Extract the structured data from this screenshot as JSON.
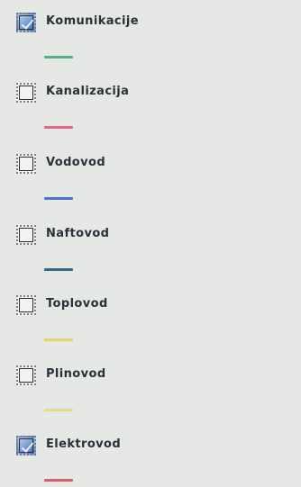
{
  "layers": [
    {
      "label": "Komunikacije",
      "checked": true,
      "color": "#58b08b"
    },
    {
      "label": "Kanalizacija",
      "checked": false,
      "color": "#e2668b"
    },
    {
      "label": "Vodovod",
      "checked": false,
      "color": "#4b75c8"
    },
    {
      "label": "Naftovod",
      "checked": false,
      "color": "#2f6b83"
    },
    {
      "label": "Toplovod",
      "checked": false,
      "color": "#e1d56a"
    },
    {
      "label": "Plinovod",
      "checked": false,
      "color": "#e2dd8d"
    },
    {
      "label": "Elektrovod",
      "checked": true,
      "color": "#e15a6c"
    }
  ]
}
